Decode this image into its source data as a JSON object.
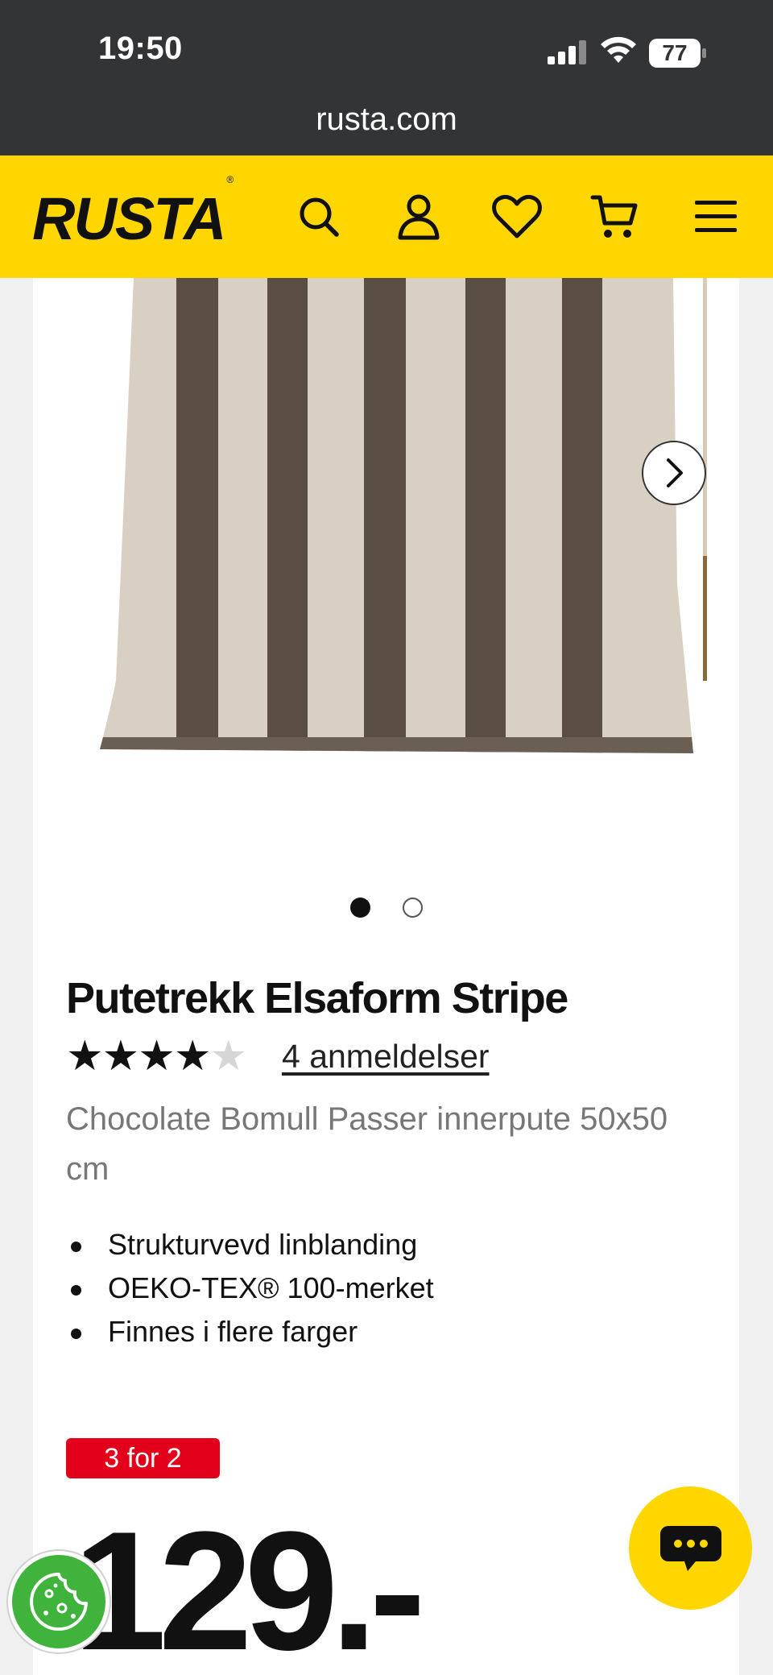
{
  "status_bar": {
    "time": "19:50",
    "url": "rusta.com",
    "battery": "77"
  },
  "header": {
    "logo": "RUSTA",
    "logo_mark": "®",
    "icons": [
      "search-icon",
      "account-icon",
      "heart-icon",
      "cart-icon",
      "menu-icon"
    ],
    "background_color": "#ffd600"
  },
  "gallery": {
    "pages": 2,
    "active_page": 1,
    "next_icon": "chevron-right-icon"
  },
  "product": {
    "title": "Putetrekk Elsaform Stripe",
    "rating": 4,
    "rating_max": 5,
    "stars_filled": "★★★★",
    "stars_empty": "★",
    "reviews_link": "4 anmeldelser",
    "description": "Chocolate Bomull Passer innerpute 50x50 cm",
    "features": [
      "Strukturvevd linblanding",
      "OEKO-TEX® 100-merket",
      "Finnes i flere farger"
    ],
    "badge": "3 for 2",
    "badge_color": "#e2001a",
    "price": "129.-"
  },
  "floating": {
    "chat_icon": "chat-bubble-icon",
    "cookie_icon": "cookie-icon"
  }
}
